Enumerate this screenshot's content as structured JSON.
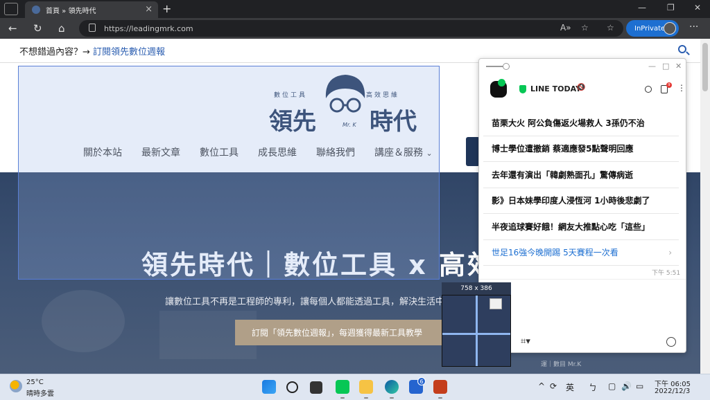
{
  "browser": {
    "tab_title": "首頁 » 領先時代",
    "url": "https://leadingmrk.com",
    "inprivate_label": "InPrivate"
  },
  "site": {
    "promo_text": "不想錯過內容？→ ",
    "promo_link": "訂閱領先數位週報",
    "logo_sub_left": "數位工具",
    "logo_sub_right": "高效思維",
    "logo_main_left": "領先",
    "logo_main_right": "時代",
    "logo_badge": "Mr. K",
    "nav": [
      "關於本站",
      "最新文章",
      "數位工具",
      "成長思維",
      "聯絡我們",
      "講座＆服務"
    ],
    "hero_title": "領先時代｜數位工具 x 高效",
    "hero_subtitle": "讓數位工具不再是工程師的專利，讓每個人都能透過工具，解決生活中的",
    "hero_button": "訂閱「領先數位週報」，每週獲得最新工具教學",
    "hero_mark": "運｜數目 Mr.K"
  },
  "line_popup": {
    "title": "LINE TODAY",
    "news": [
      "苗栗大火 阿公負傷返火場救人 3孫仍不治",
      "博士學位遭撤銷 蔡適應發5點聲明回應",
      "去年還有演出「韓劇熟面孔」驚傳病逝",
      "影》日本妹學印度人浸恆河 1小時後悲劇了",
      "半夜追球賽好餓！網友大推點心吃「這些」"
    ],
    "link_item": "世足16強今晚開踢 5天賽程一次看",
    "time": "下午 5:51",
    "badge_count": "9"
  },
  "capture": {
    "size_label": "758 x 386"
  },
  "taskbar": {
    "temperature": "25°C",
    "weather": "晴時多雲",
    "ime_lang": "英",
    "time": "下午 06:05",
    "date": "2022/12/3",
    "todo_badge": "6"
  }
}
